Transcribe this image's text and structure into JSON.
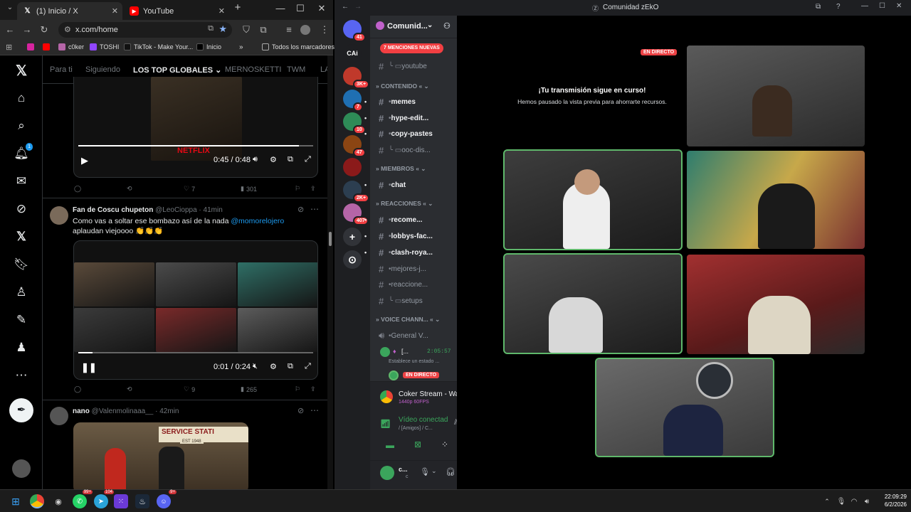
{
  "browser": {
    "tabs": [
      {
        "title": "(1) Inicio / X",
        "icon": "x-logo-icon"
      },
      {
        "title": "YouTube",
        "icon": "youtube-icon"
      }
    ],
    "address": "x.com/home",
    "bookmarks": [
      "c0ker",
      "TOSHI",
      "TikTok - Make Your...",
      "Inicio"
    ],
    "all_bookmarks": "Todos los marcadores"
  },
  "x": {
    "tabs": [
      "Para ti",
      "Siguiendo",
      "LOS TOP GLOBALES",
      "MERNOSKETTI",
      "TWM",
      "LA"
    ],
    "notification_count": "1",
    "post1": {
      "time": "0:45 / 0:48",
      "progress": 0.94,
      "watermark": "NETFLIX",
      "likes": "7",
      "views": "301"
    },
    "post2": {
      "author": "Fan de Coscu chupeton",
      "handle": "@LeoCioppa · 41min",
      "text_before": "Como vas a soltar ese bombazo así de la nada ",
      "mention": "@momorelojero",
      "text_after": " aplaudan viejoooo 👏👏👏",
      "time": "0:01 / 0:24",
      "progress": 0.06,
      "likes": "9",
      "views": "265"
    },
    "post3": {
      "author": "nano",
      "handle": "@Valenmolinaaa__ · 42min",
      "image_sign": "SERVICE STATI",
      "image_est": "EST 1948"
    }
  },
  "discord": {
    "window_title": "Comunidad zEkO",
    "server_name": "Comunid...",
    "mentions_pill": "7 MENCIONES NUEVAS",
    "servers": [
      {
        "label": "",
        "badge": "41",
        "color": "#5865f2"
      },
      {
        "label": "CAi",
        "badge": "",
        "color": "#1e1f22"
      },
      {
        "label": "",
        "badge": "3K+",
        "color": "#c0392b"
      },
      {
        "label": "",
        "badge": "7",
        "color": "#1f6fb2"
      },
      {
        "label": "",
        "badge": "10",
        "color": "#2e8b57"
      },
      {
        "label": "",
        "badge": "47",
        "color": "#8b4513"
      },
      {
        "label": "",
        "badge": "",
        "color": "#8b1a1a"
      },
      {
        "label": "",
        "badge": "2K+",
        "color": "#2c3e50"
      },
      {
        "label": "",
        "badge": "407",
        "color": "#b565a7"
      }
    ],
    "channels": [
      {
        "name": "youtube",
        "type": "thread"
      },
      {
        "name": "CONTENIDO",
        "type": "category"
      },
      {
        "name": "memes",
        "type": "channel",
        "unread": true
      },
      {
        "name": "hype-edit...",
        "type": "channel",
        "unread": true
      },
      {
        "name": "copy-pastes",
        "type": "channel",
        "unread": true
      },
      {
        "name": "ooc-dis...",
        "type": "thread"
      },
      {
        "name": "MIEMBROS",
        "type": "category"
      },
      {
        "name": "chat",
        "type": "channel",
        "unread": true
      },
      {
        "name": "REACCIONES",
        "type": "category"
      },
      {
        "name": "recome...",
        "type": "channel",
        "unread": true
      },
      {
        "name": "lobbys-fac...",
        "type": "channel",
        "unread": true
      },
      {
        "name": "clash-roya...",
        "type": "channel",
        "unread": true
      },
      {
        "name": "mejores-j...",
        "type": "channel"
      },
      {
        "name": "reaccione...",
        "type": "channel"
      },
      {
        "name": "setups",
        "type": "thread"
      },
      {
        "name": "VOICE CHANN...",
        "type": "category"
      },
      {
        "name": "General V...",
        "type": "voice"
      }
    ],
    "voice_user": {
      "name": "[...",
      "timer": "2:05:57",
      "status": "Establece un estado ..."
    },
    "live_label": "EN DIRECTO",
    "stream": {
      "title": "Coker Stream - Wa...",
      "quality": "1440p 60FPS"
    },
    "voice_status": {
      "title": "Vídeo conectad",
      "sub": "/ [Amigos] / C..."
    },
    "user_panel": {
      "name": "c...",
      "status": "c"
    },
    "stage": {
      "message_title": "¡Tu transmisión sigue en curso!",
      "message_sub": "Hemos pausado la vista previa para ahorrarte recursos."
    }
  },
  "taskbar": {
    "time": "22:09:29",
    "date": "6/2/2026",
    "badges": {
      "whatsapp": "99+",
      "telegram": "104",
      "discord": "9+"
    }
  }
}
